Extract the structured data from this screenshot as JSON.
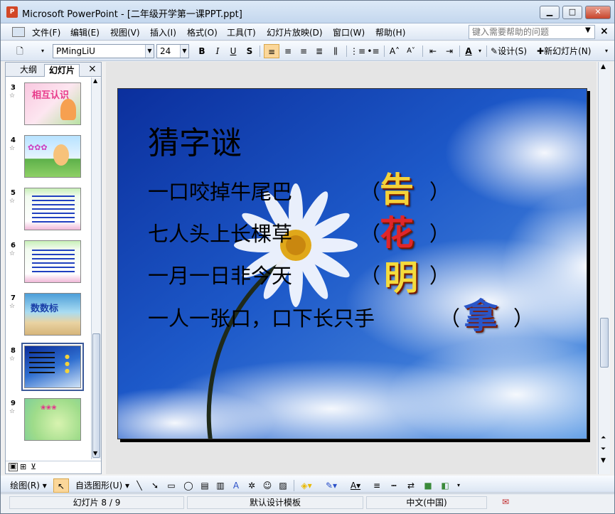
{
  "window": {
    "title": "Microsoft PowerPoint - [二年级开学第一课PPT.ppt]",
    "app_icon": "P"
  },
  "menu": [
    "文件(F)",
    "编辑(E)",
    "视图(V)",
    "插入(I)",
    "格式(O)",
    "工具(T)",
    "幻灯片放映(D)",
    "窗口(W)",
    "帮助(H)"
  ],
  "help": {
    "placeholder": "键入需要帮助的问题"
  },
  "format": {
    "font": "PMingLiU",
    "size": "24",
    "design_label": "设计(S)",
    "new_slide_label": "新幻灯片(N)"
  },
  "pane": {
    "tabs": [
      "大纲",
      "幻灯片"
    ],
    "thumbs": [
      {
        "num": "3",
        "text": "相互认识"
      },
      {
        "num": "4",
        "text": ""
      },
      {
        "num": "5",
        "text": ""
      },
      {
        "num": "6",
        "text": ""
      },
      {
        "num": "7",
        "text": "数数标"
      },
      {
        "num": "8",
        "text": ""
      },
      {
        "num": "9",
        "text": ""
      }
    ]
  },
  "slide": {
    "title": "猜字谜",
    "riddles": [
      {
        "text": "一口咬掉牛尾巴",
        "answer": "告",
        "color": "#f4d23a"
      },
      {
        "text": "七人头上长棵草",
        "answer": "花",
        "color": "#e0262a"
      },
      {
        "text": "一月一日非今天",
        "answer": "明",
        "color": "#f5dc3c"
      },
      {
        "text": "一人一张口，口下长只手",
        "answer": "拿",
        "color": "#2a56c8"
      }
    ]
  },
  "drawbar": {
    "draw_label": "绘图(R)",
    "autoshape_label": "自选图形(U)"
  },
  "status": {
    "slide": "幻灯片 8 / 9",
    "template": "默认设计模板",
    "language": "中文(中国)"
  }
}
